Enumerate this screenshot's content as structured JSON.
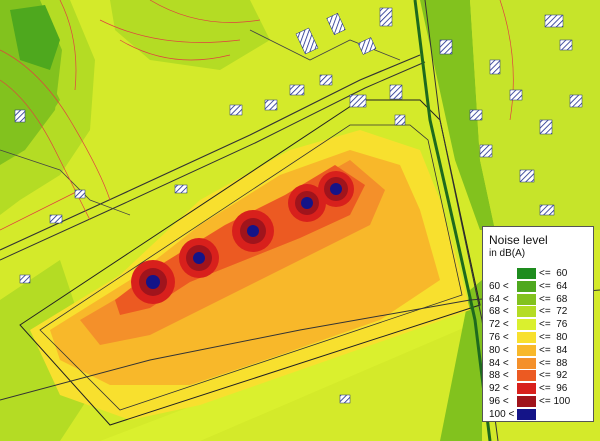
{
  "legend": {
    "title": "Noise level",
    "subtitle": "in dB(A)",
    "classes": [
      {
        "lower": "",
        "upper": "<=  60",
        "color": "#1e8c1e"
      },
      {
        "lower": "60 <",
        "upper": "<=  64",
        "color": "#4ea81e"
      },
      {
        "lower": "64 <",
        "upper": "<=  68",
        "color": "#82c21e"
      },
      {
        "lower": "68 <",
        "upper": "<=  72",
        "color": "#b4dc24"
      },
      {
        "lower": "72 <",
        "upper": "<=  76",
        "color": "#daf02e"
      },
      {
        "lower": "76 <",
        "upper": "<=  80",
        "color": "#f8e02e"
      },
      {
        "lower": "80 <",
        "upper": "<=  84",
        "color": "#f8b82a"
      },
      {
        "lower": "84 <",
        "upper": "<=  88",
        "color": "#f4902a"
      },
      {
        "lower": "88 <",
        "upper": "<=  92",
        "color": "#ec5a22"
      },
      {
        "lower": "92 <",
        "upper": "<=  96",
        "color": "#d8201c"
      },
      {
        "lower": "96 <",
        "upper": "<= 100",
        "color": "#a0141c"
      },
      {
        "lower": "100 <",
        "upper": "",
        "color": "#141488"
      }
    ]
  },
  "map": {
    "background_color": "#d6ec2c",
    "noise_sources": 5
  }
}
